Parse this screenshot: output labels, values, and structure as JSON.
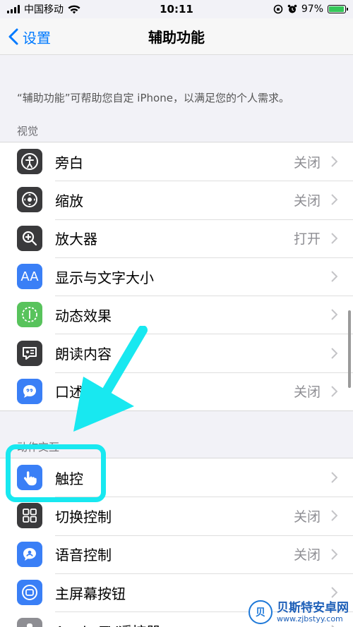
{
  "status_bar": {
    "carrier": "中国移动",
    "time": "10:11",
    "battery": "97%"
  },
  "nav": {
    "back_label": "设置",
    "title": "辅助功能"
  },
  "description": "“辅助功能”可帮助您自定 iPhone，以满足您的个人需求。",
  "vision": {
    "header": "视觉",
    "items": [
      {
        "label": "旁白",
        "value": "关闭",
        "icon": "voiceover-icon"
      },
      {
        "label": "缩放",
        "value": "关闭",
        "icon": "zoom-icon"
      },
      {
        "label": "放大器",
        "value": "打开",
        "icon": "magnifier-icon"
      },
      {
        "label": "显示与文字大小",
        "value": "",
        "icon": "text-size-icon",
        "icon_text": "AA"
      },
      {
        "label": "动态效果",
        "value": "",
        "icon": "motion-icon"
      },
      {
        "label": "朗读内容",
        "value": "",
        "icon": "spoken-content-icon"
      },
      {
        "label": "口述",
        "value": "关闭",
        "icon": "audio-description-icon"
      }
    ]
  },
  "interaction": {
    "header": "动作交互",
    "items": [
      {
        "label": "触控",
        "value": "",
        "icon": "touch-icon"
      },
      {
        "label": "切换控制",
        "value": "关闭",
        "icon": "switch-control-icon"
      },
      {
        "label": "语音控制",
        "value": "关闭",
        "icon": "voice-control-icon"
      },
      {
        "label": "主屏幕按钮",
        "value": "",
        "icon": "home-button-icon"
      },
      {
        "label": "Apple TV遥控器",
        "value": "",
        "icon": "remote-icon"
      }
    ]
  },
  "watermark": {
    "logo": "贝",
    "title": "贝斯特安卓网",
    "url": "www.zjbstyy.com"
  },
  "colors": {
    "accent": "#007aff",
    "highlight": "#18e8f0",
    "icon_dark": "#3a3a3c",
    "icon_blue": "#3a7ff6",
    "icon_green": "#58c35c"
  }
}
